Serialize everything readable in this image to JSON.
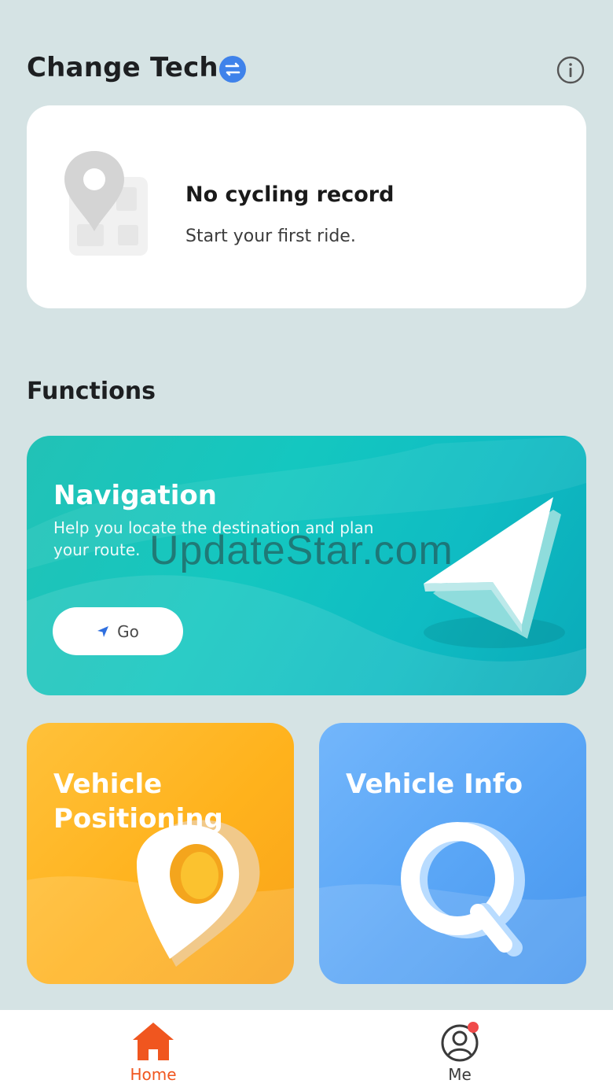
{
  "header": {
    "title": "Change Tech",
    "switch_icon": "switch-icon",
    "info_icon": "info-icon"
  },
  "record": {
    "title": "No cycling record",
    "subtitle": "Start your first ride.",
    "icon": "map-pin-icon"
  },
  "functions": {
    "section_title": "Functions",
    "navigation": {
      "title": "Navigation",
      "description": "Help you locate the destination and plan your route.",
      "button_label": "Go",
      "button_icon": "location-arrow-icon"
    },
    "positioning": {
      "title": "Vehicle Positioning",
      "icon": "map-pin-icon"
    },
    "info": {
      "title": "Vehicle Info",
      "icon": "search-icon"
    }
  },
  "tabbar": {
    "home_label": "Home",
    "me_label": "Me",
    "active_color": "#f0561f"
  },
  "watermark": "UpdateStar.com"
}
